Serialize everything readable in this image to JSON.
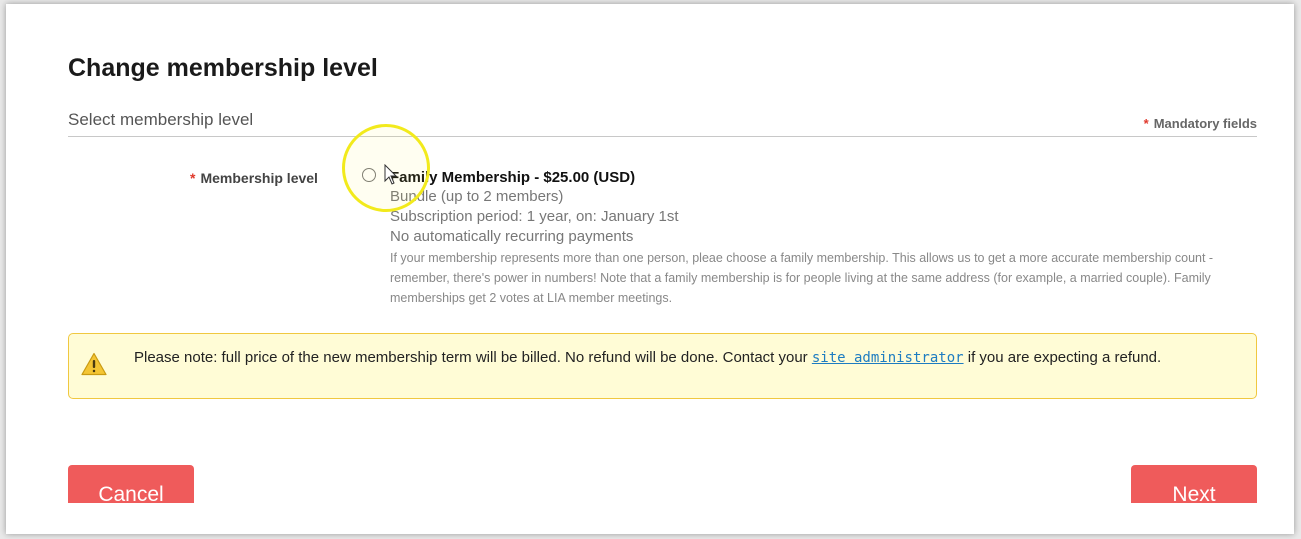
{
  "page": {
    "title": "Change membership level",
    "section_title": "Select membership level",
    "mandatory_marker": "*",
    "mandatory_label": "Mandatory fields"
  },
  "field": {
    "required_marker": "*",
    "label": "Membership level"
  },
  "option": {
    "title": "Family Membership - $25.00 (USD)",
    "bundle": "Bundle (up to 2 members)",
    "period": "Subscription period: 1 year, on: January 1st",
    "recurring": "No automatically recurring payments",
    "description": "If your membership represents more than one person, pleae choose a family membership. This allows us to get a more accurate membership count - remember, there's power in numbers! Note that a family membership is for people living at the same address (for example, a married couple). Family memberships get 2 votes at LIA member meetings.",
    "selected": false
  },
  "notice": {
    "text_before": "Please note: full price of the new membership term will be billed. No refund will be done. Contact your ",
    "link_text": "site administrator",
    "text_after": " if you are expecting a refund.",
    "icon": "warning-icon"
  },
  "buttons": {
    "cancel_label": "Cancel",
    "next_label": "Next"
  },
  "colors": {
    "button": "#ef5b5b",
    "notice_bg": "#fffcd6",
    "notice_border": "#f0c840",
    "link": "#1d7cc1",
    "required": "#e0382b",
    "highlight_ring": "#f2ea1c"
  }
}
